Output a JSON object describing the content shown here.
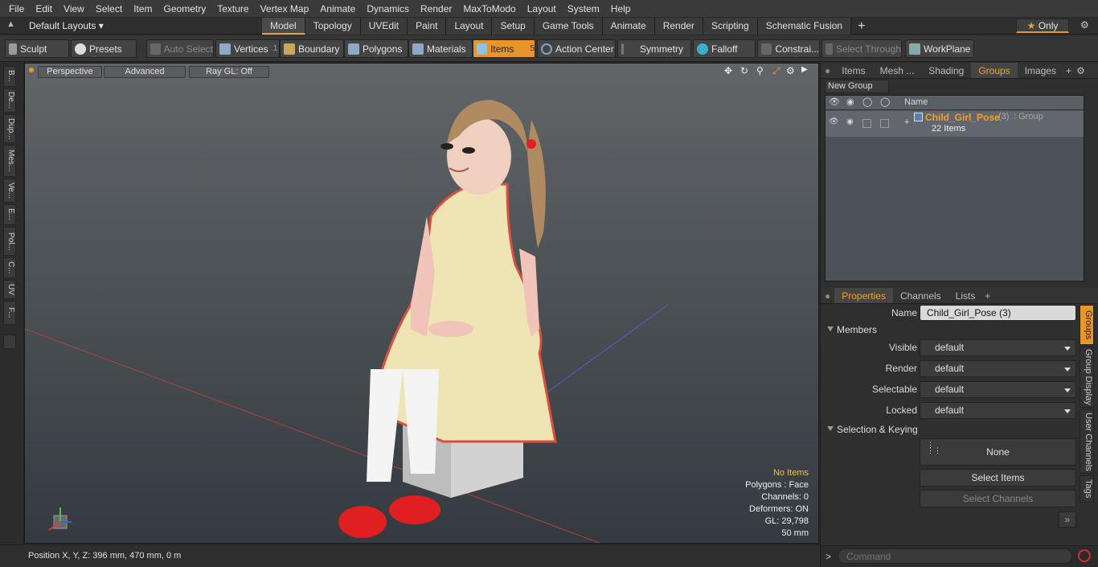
{
  "menu": [
    "File",
    "Edit",
    "View",
    "Select",
    "Item",
    "Geometry",
    "Texture",
    "Vertex Map",
    "Animate",
    "Dynamics",
    "Render",
    "MaxToModo",
    "Layout",
    "System",
    "Help"
  ],
  "layout_label": "Default Layouts",
  "tabs": [
    "Model",
    "Topology",
    "UVEdit",
    "Paint",
    "Layout",
    "Setup",
    "Game Tools",
    "Animate",
    "Render",
    "Scripting",
    "Schematic Fusion"
  ],
  "only_label": "Only",
  "toolbar": {
    "sculpt": "Sculpt",
    "presets": "Presets",
    "auto_select": "Auto Select",
    "vertices": "Vertices",
    "vertices_count": "1",
    "boundary": "Boundary",
    "polygons": "Polygons",
    "materials": "Materials",
    "items": "Items",
    "items_count": "5",
    "action_center": "Action Center",
    "symmetry": "Symmetry",
    "falloff": "Falloff",
    "constrain": "Constrai...",
    "select_through": "Select Through",
    "workplane": "WorkPlane"
  },
  "left_tabs": [
    "B...",
    "De...",
    "Dup...",
    "Mes...",
    "Ve...",
    "E...",
    "Pol...",
    "C...",
    "UV",
    "F..."
  ],
  "viewport": {
    "perspective": "Perspective",
    "advanced": "Advanced",
    "raygl": "Ray GL: Off",
    "stats": {
      "no_items": "No Items",
      "polygons": "Polygons : Face",
      "channels": "Channels: 0",
      "deformers": "Deformers: ON",
      "gl": "GL: 29,798",
      "scale": "50 mm"
    }
  },
  "status": {
    "position": "Position X, Y, Z:   396 mm, 470 mm, 0 m"
  },
  "top_panel": {
    "tabs": [
      "Items",
      "Mesh ...",
      "Shading",
      "Groups",
      "Images"
    ],
    "new_group": "New Group",
    "col_name": "Name",
    "group": {
      "name": "Child_Girl_Pose",
      "count": "(3)",
      "type": ": Group",
      "items": "22 Items"
    }
  },
  "props": {
    "tabs": [
      "Properties",
      "Channels",
      "Lists"
    ],
    "name_label": "Name",
    "name_value": "Child_Girl_Pose (3)",
    "members": "Members",
    "visible_label": "Visible",
    "visible_value": "default",
    "render_label": "Render",
    "render_value": "default",
    "selectable_label": "Selectable",
    "selectable_value": "default",
    "locked_label": "Locked",
    "locked_value": "default",
    "selkey": "Selection & Keying",
    "none": "None",
    "select_items": "Select Items",
    "select_channels": "Select Channels",
    "side_tabs": [
      "Groups",
      "Group Display",
      "User Channels",
      "Tags"
    ]
  },
  "command_placeholder": "Command",
  "colors": {
    "accent": "#e8962a",
    "group_name": "#f0a030"
  }
}
